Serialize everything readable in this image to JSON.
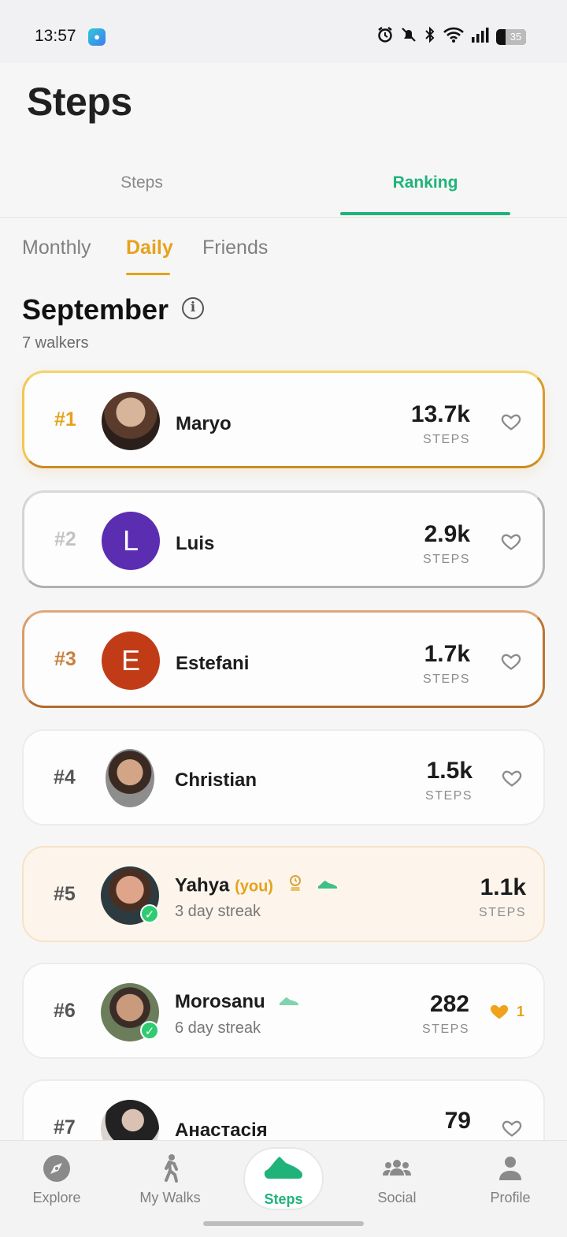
{
  "status_bar": {
    "time": "13:57",
    "battery": "35"
  },
  "header": {
    "title": "Steps"
  },
  "main_tabs": [
    {
      "label": "Steps",
      "active": false
    },
    {
      "label": "Ranking",
      "active": true
    }
  ],
  "sub_tabs": [
    {
      "label": "Monthly",
      "active": false
    },
    {
      "label": "Daily",
      "active": true
    },
    {
      "label": "Friends",
      "active": false
    }
  ],
  "section": {
    "title": "September",
    "subtitle": "7 walkers"
  },
  "ranking": [
    {
      "rank": "#1",
      "name": "Maryo",
      "steps": "13.7k",
      "steps_label": "STEPS",
      "avatar": "photo",
      "liked": false
    },
    {
      "rank": "#2",
      "name": "Luis",
      "initial": "L",
      "avatar_color": "#5b2db0",
      "steps": "2.9k",
      "steps_label": "STEPS",
      "liked": false
    },
    {
      "rank": "#3",
      "name": "Estefani",
      "initial": "E",
      "avatar_color": "#c23b17",
      "steps": "1.7k",
      "steps_label": "STEPS",
      "liked": false
    },
    {
      "rank": "#4",
      "name": "Christian",
      "steps": "1.5k",
      "steps_label": "STEPS",
      "avatar": "photo",
      "liked": false
    },
    {
      "rank": "#5",
      "name": "Yahya",
      "you_tag": "(you)",
      "streak": "3 day streak",
      "steps": "1.1k",
      "steps_label": "STEPS",
      "avatar": "photo",
      "badges": [
        "trophy-icon",
        "sneaker-icon"
      ]
    },
    {
      "rank": "#6",
      "name": "Morosanu",
      "streak": "6 day streak",
      "steps": "282",
      "steps_label": "STEPS",
      "avatar": "photo",
      "liked": true,
      "likes": "1",
      "badges": [
        "sneaker-icon"
      ]
    },
    {
      "rank": "#7",
      "name": "Анастасія",
      "steps": "79",
      "avatar": "photo",
      "liked": false
    }
  ],
  "colors": {
    "accent_green": "#1fb37a",
    "accent_orange": "#e6a21b"
  },
  "bottom_nav": [
    {
      "label": "Explore",
      "icon": "compass-icon"
    },
    {
      "label": "My Walks",
      "icon": "walker-icon"
    },
    {
      "label": "Steps",
      "icon": "shoe-icon",
      "active": true
    },
    {
      "label": "Social",
      "icon": "group-icon"
    },
    {
      "label": "Profile",
      "icon": "person-icon"
    }
  ]
}
